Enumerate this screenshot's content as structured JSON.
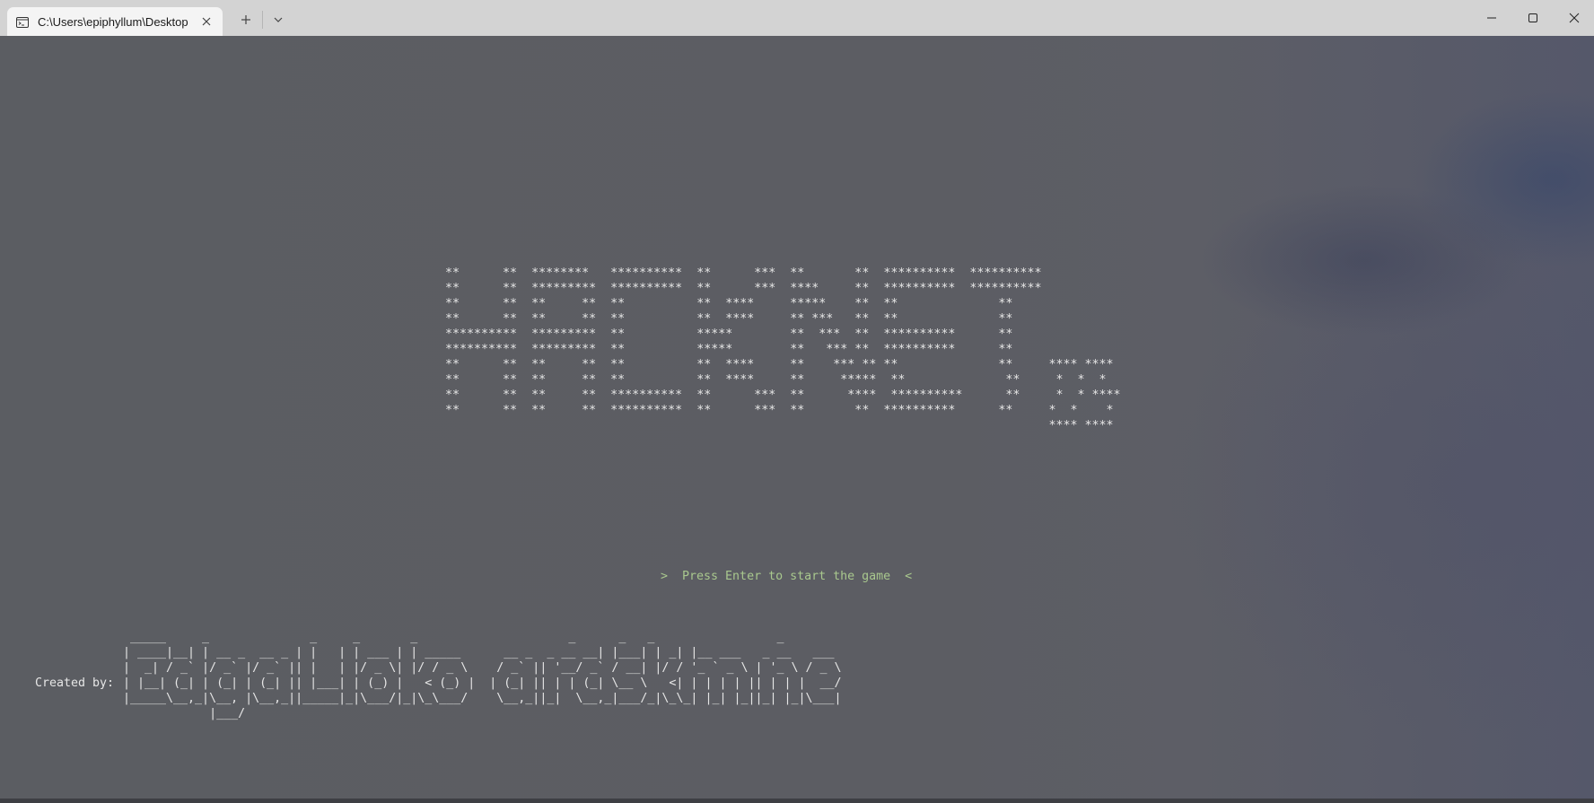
{
  "window": {
    "tab_title": "C:\\Users\\epiphyllum\\Desktop",
    "tab_icon": "terminal-icon",
    "new_tab_icon": "plus-icon",
    "dropdown_icon": "chevron-down-icon",
    "minimize_icon": "minimize-icon",
    "maximize_icon": "maximize-icon",
    "close_icon": "close-icon"
  },
  "game": {
    "title_art": "**      **  ********   **********  **      ***  **       **  **********  **********\n**      **  *********  **********  **      ***  ****     **  **********  **********\n**      **  **     **  **          **  ****     *****    **  **              **\n**      **  **     **  **          **  ****     ** ***   **  **              **\n**********  *********  **          *****        **  ***  **  **********      **\n**********  *********  **          *****        **   *** **  **********      **\n**      **  **     **  **          **  ****     **    *** ** **              **     **** ****\n**      **  **     **  **          **  ****     **     *****  **              **     *  *  *\n**      **  **     **  **********  **      ***  **      ****  **********      **     *  * ****\n**      **  **     **  **********  **      ***  **       **  **********      **     *  *    *\n                                                                                    **** ****",
    "prompt": ">  Press Enter to start the game  <",
    "credits_label": "Created by:",
    "credits_art": " _____     _              _     _       _                     _      _   _                 _\n| ____|__| | __ _  __ _ | |   | | ___ | | _____      __ _  _ __ __| |___| | _| |__ ___   _ __   ___\n|  _| / _` |/ _` |/ _` || |   | |/ _ \\| |/ / _ \\    / _` || '__/ _` / __| |/ / '_ ` _ \\ | '_ \\ / _ \\\n| |__| (_| | (_| | (_| || |___| | (_) |   < (_) |  | (_| || | | (_| \\__ \\   <| | | | | || | | |  __/\n|_____\\__,_|\\__, |\\__,_||_____|_|\\___/|_|\\_\\___/    \\__,_||_|  \\__,_|___/_|\\_\\_| |_| |_||_| |_|\\___|\n            |___/"
  },
  "colors": {
    "terminal_bg": "#5b5d62",
    "text": "#e6e6e6",
    "prompt": "#a9c88e",
    "titlebar": "#d3d3d3"
  }
}
